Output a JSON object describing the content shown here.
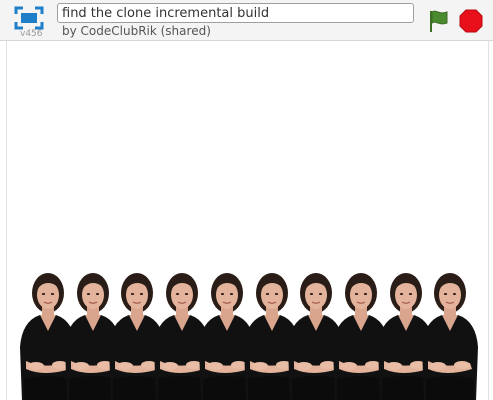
{
  "project": {
    "title": "find the clone incremental build",
    "byline": "by CodeClubRik (shared)",
    "version": "v456"
  },
  "controls": {
    "green_flag_icon": "green-flag-icon",
    "stop_icon": "stop-sign-icon"
  },
  "stage": {
    "sprite_clone_count": 10
  },
  "colors": {
    "accent_blue": "#1e7ec8",
    "flag_green": "#4b8a2e",
    "stop_red": "#e8101a",
    "topbar_bg": "#f4f4f4"
  }
}
